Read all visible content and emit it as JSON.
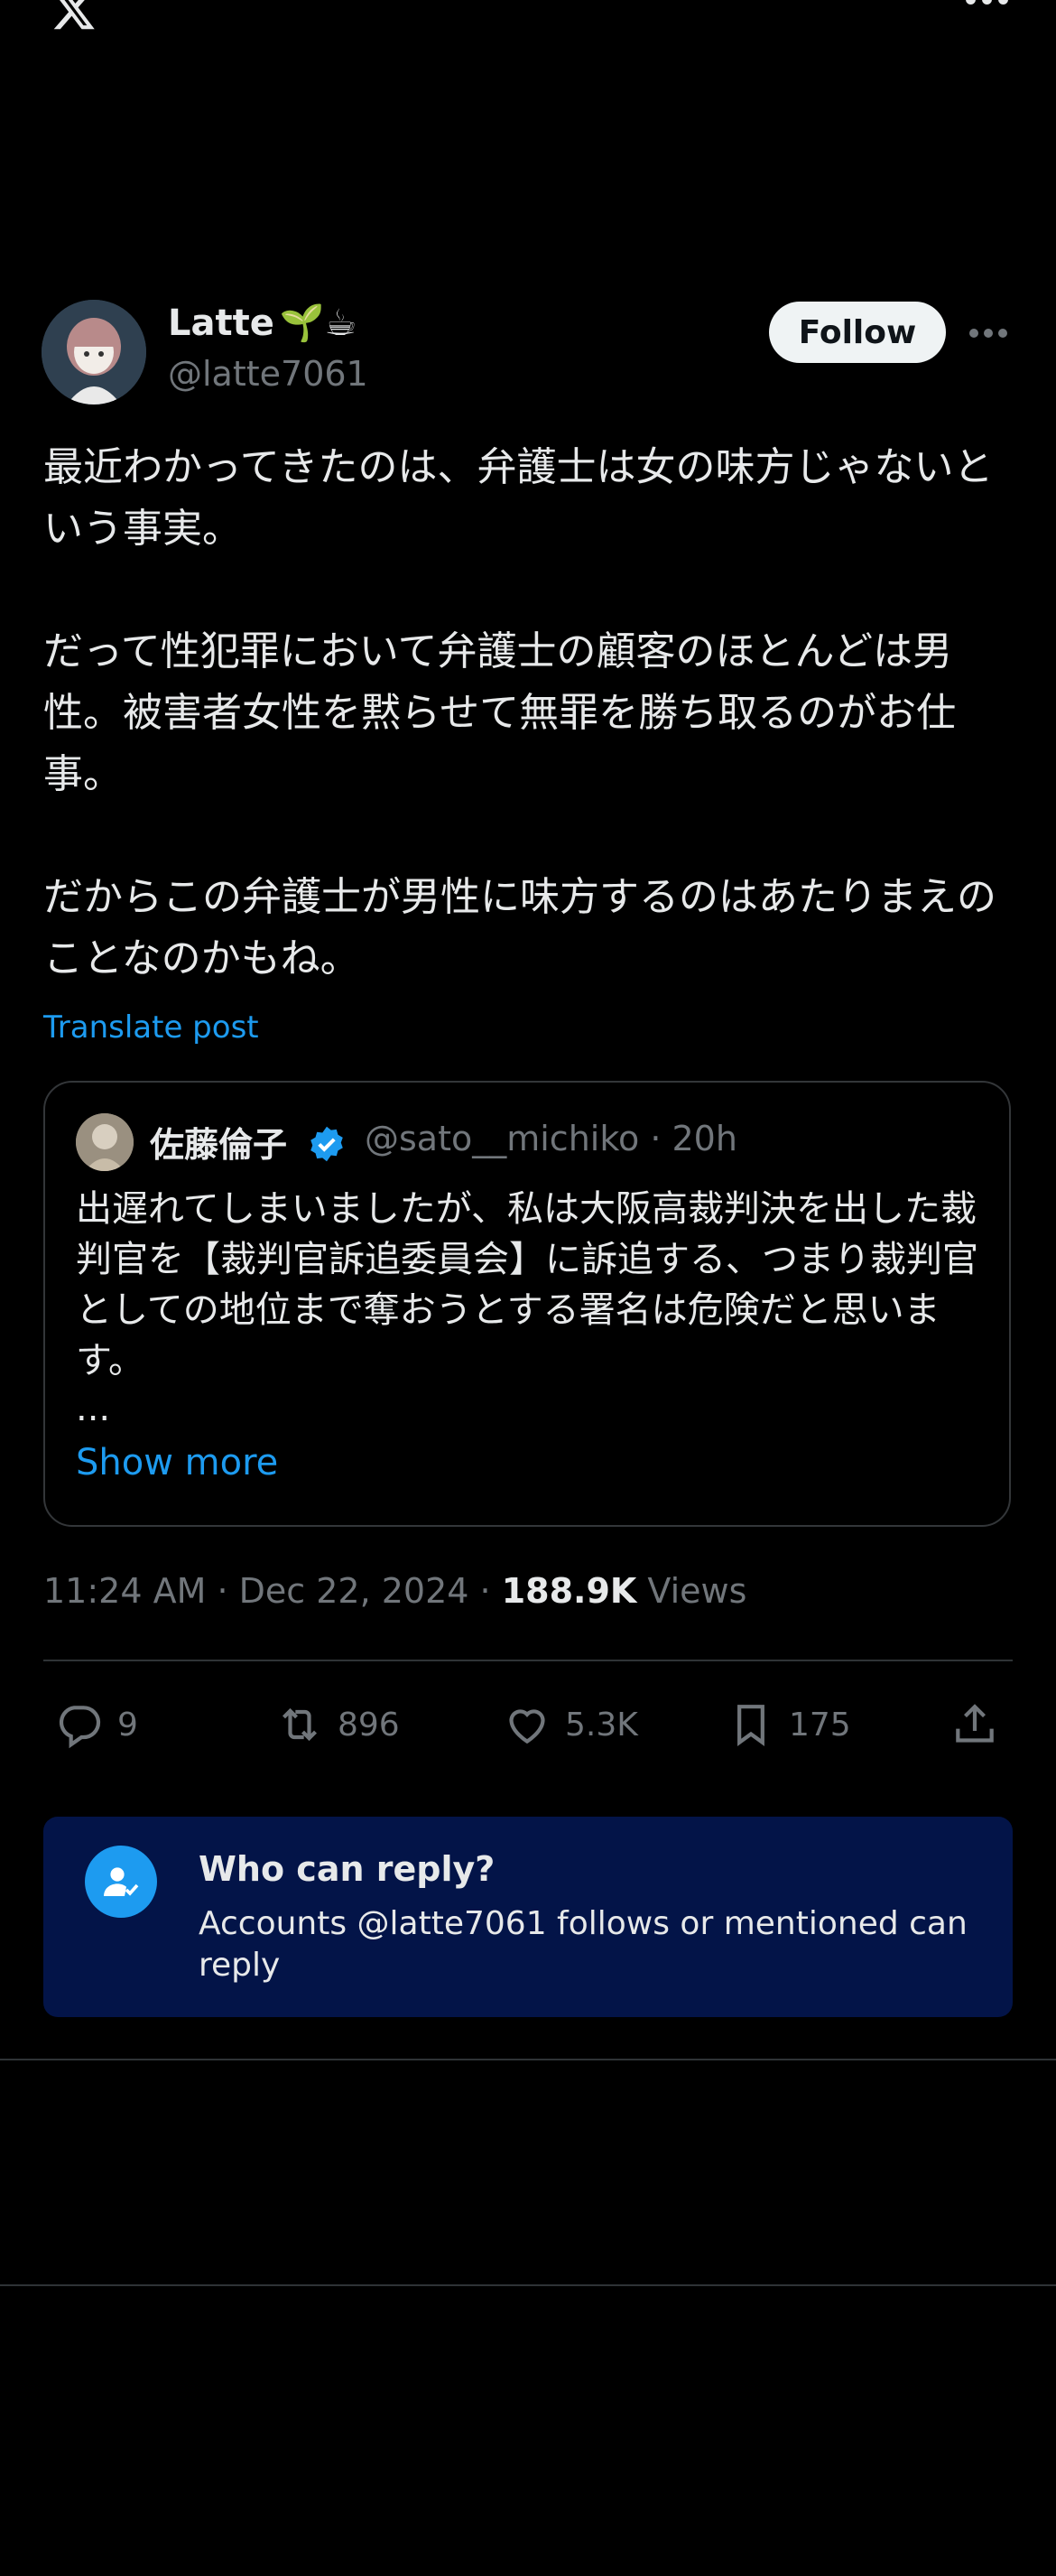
{
  "topbar": {
    "logo_icon": "x-logo-icon",
    "more_icon": "more-horizontal-icon"
  },
  "author": {
    "name": "Latte",
    "handle": "@latte7061",
    "emoji": "🌱☕"
  },
  "follow_label": "Follow",
  "tweet": {
    "text": "最近わかってきたのは、弁護士は女の味方じゃないという事実。\n\nだって性犯罪において弁護士の顧客のほとんどは男性。被害者女性を黙らせて無罪を勝ち取るのがお仕事。\n\nだからこの弁護士が男性に味方するのはあたりまえのことなのかもね。",
    "translate_label": "Translate post"
  },
  "quote": {
    "name": "佐藤倫子",
    "handle": "@sato__michiko · 20h",
    "text": "出遅れてしまいましたが、私は大阪高裁判決を出した裁判官を【裁判官訴追委員会】に訴追する、つまり裁判官としての地位まで奪おうとする署名は危険だと思います。",
    "ellipsis": "...",
    "show_more": "Show more"
  },
  "meta": {
    "time": "11:24 AM · Dec 22, 2024 · ",
    "views_count": "188.9K",
    "views_label": " Views"
  },
  "actions": {
    "replies": "9",
    "reposts": "896",
    "likes": "5.3K",
    "bookmarks": "175"
  },
  "reply_settings": {
    "title": "Who can reply?",
    "subtitle": "Accounts @latte7061 follows or mentioned can reply"
  },
  "colors": {
    "accent": "#1d9bf0",
    "reply_box_bg": "#031448",
    "background": "#000000"
  }
}
